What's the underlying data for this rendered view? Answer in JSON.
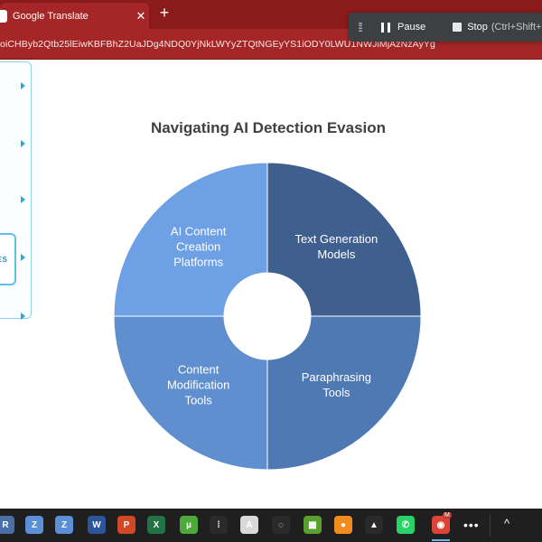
{
  "browser": {
    "tab_title": "Google Translate",
    "tab_close": "✕",
    "new_tab": "+",
    "url": "oiCHByb2Qtb25lEiwKBFBhZ2UaJDg4NDQ0YjNkLWYyZTQtNGEyYS1iODY0LWU1NWJiMjAzNzAyYg"
  },
  "recording_controls": {
    "pause_label": "Pause",
    "stop_label": "Stop",
    "stop_hint": "(Ctrl+Shift+"
  },
  "outline_panel": {
    "label_fragment": "YLES"
  },
  "chart_data": {
    "type": "pie",
    "title": "Navigating AI Detection Evasion",
    "donut": true,
    "slices": [
      {
        "label": "Text Generation Models",
        "lines": [
          "Text Generation",
          "Models"
        ],
        "value": 25,
        "color": "#3f5f8f"
      },
      {
        "label": "Paraphrasing Tools",
        "lines": [
          "Paraphrasing",
          "Tools"
        ],
        "value": 25,
        "color": "#4f79b2"
      },
      {
        "label": "Content Modification Tools",
        "lines": [
          "Content",
          "Modification",
          "Tools"
        ],
        "value": 25,
        "color": "#5f8fcf"
      },
      {
        "label": "AI Content Creation Platforms",
        "lines": [
          "AI Content",
          "Creation",
          "Platforms"
        ],
        "value": 25,
        "color": "#6ea0e6"
      }
    ]
  },
  "taskbar": {
    "icons": [
      {
        "name": "app-r-icon",
        "glyph": "R",
        "color": "#4a6fa8"
      },
      {
        "name": "zoom-icon-1",
        "glyph": "Z",
        "color": "#5b8fd6"
      },
      {
        "name": "zoom-icon-2",
        "glyph": "Z",
        "color": "#5b8fd6"
      },
      {
        "name": "word-icon",
        "glyph": "W",
        "color": "#2b579a"
      },
      {
        "name": "powerpoint-icon",
        "glyph": "P",
        "color": "#d24726"
      },
      {
        "name": "excel-icon",
        "glyph": "X",
        "color": "#217346"
      },
      {
        "name": "utorrent-icon",
        "glyph": "µ",
        "color": "#4ea93b"
      },
      {
        "name": "app-grid-icon",
        "glyph": "⁞",
        "color": "#2a2a2a"
      },
      {
        "name": "pdf-icon",
        "glyph": "A",
        "color": "#d9d9d9"
      },
      {
        "name": "refresh-circle-icon",
        "glyph": "◌",
        "color": "#2a2a2a"
      },
      {
        "name": "chart-app-icon",
        "glyph": "▦",
        "color": "#5aa02c"
      },
      {
        "name": "orange-app-icon",
        "glyph": "●",
        "color": "#f28c1c"
      },
      {
        "name": "vlc-icon",
        "glyph": "▲",
        "color": "#2a2a2a"
      },
      {
        "name": "whatsapp-icon",
        "glyph": "✆",
        "color": "#25d366"
      },
      {
        "name": "chrome-icon",
        "glyph": "◉",
        "color": "#db4437"
      }
    ],
    "more_label": "•••",
    "tray_caret": "^",
    "chrome_badge": "M"
  }
}
